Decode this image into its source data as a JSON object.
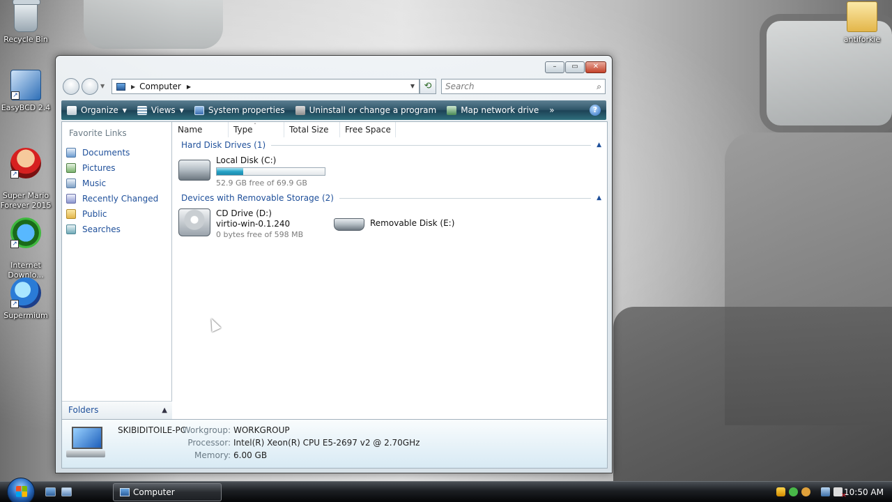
{
  "desktop": {
    "icons": [
      {
        "label": "Recycle Bin",
        "icon": "recycle-bin-icon"
      },
      {
        "label": "EasyBCD 2.4",
        "icon": "easybcd-icon"
      },
      {
        "label": "Super Mario\nForever 2015",
        "icon": "mario-icon"
      },
      {
        "label": "Internet\nDownlo...",
        "icon": "idm-icon"
      },
      {
        "label": "Supermium",
        "icon": "supermium-icon"
      },
      {
        "label": "antiforkie",
        "icon": "folder-icon"
      }
    ]
  },
  "window": {
    "caption_buttons": {
      "minimize": "–",
      "maximize": "▭",
      "close": "✕"
    },
    "address": {
      "location": "Computer"
    },
    "search": {
      "placeholder": "Search"
    },
    "toolbar": {
      "organize": "Organize",
      "views": "Views",
      "system_properties": "System properties",
      "uninstall": "Uninstall or change a program",
      "map_drive": "Map network drive",
      "more": "»",
      "help": "?"
    },
    "nav_pane": {
      "heading": "Favorite Links",
      "links": [
        "Documents",
        "Pictures",
        "Music",
        "Recently Changed",
        "Public",
        "Searches"
      ],
      "folders_label": "Folders"
    },
    "columns": [
      "Name",
      "Type",
      "Total Size",
      "Free Space"
    ],
    "groups": [
      {
        "title": "Hard Disk Drives (1)",
        "items": [
          {
            "name": "Local Disk (C:)",
            "detail": "52.9 GB free of 69.9 GB",
            "used_fraction": 0.243
          }
        ]
      },
      {
        "title": "Devices with Removable Storage (2)",
        "items": [
          {
            "name": "CD Drive (D:)",
            "label": "virtio-win-0.1.240",
            "detail": "0 bytes free of 598 MB"
          },
          {
            "name": "Removable Disk (E:)"
          }
        ]
      }
    ],
    "details": {
      "computer_name": "SKIBIDITOILE-PC",
      "workgroup_label": "Workgroup:",
      "workgroup": "WORKGROUP",
      "processor_label": "Processor:",
      "processor": "Intel(R) Xeon(R) CPU E5-2697 v2 @ 2.70GHz",
      "memory_label": "Memory:",
      "memory": "6.00 GB"
    }
  },
  "taskbar": {
    "window_button": "Computer",
    "clock": "10:50 AM"
  }
}
